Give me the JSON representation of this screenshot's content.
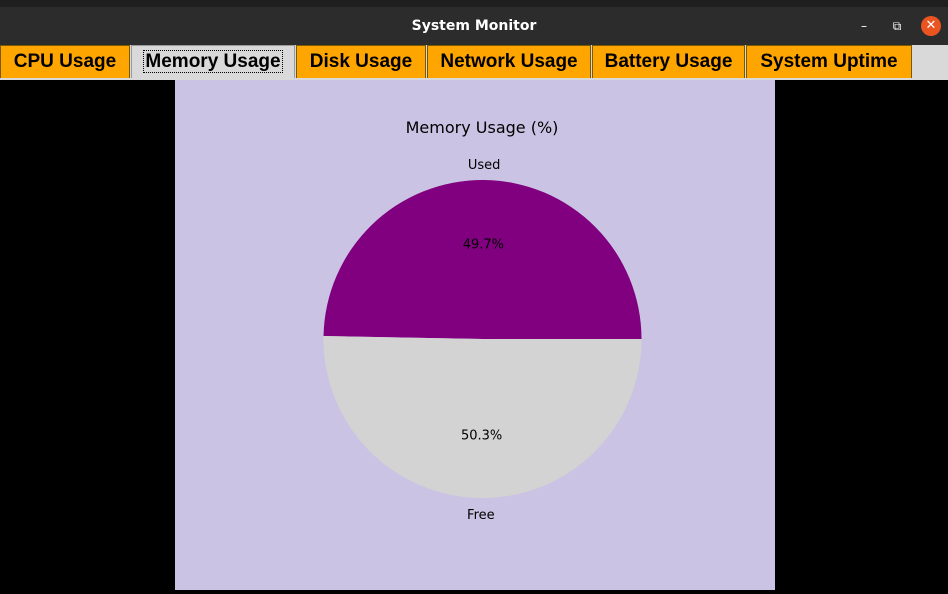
{
  "window": {
    "title": "System Monitor",
    "minimize_glyph": "–",
    "maximize_glyph": "⧉",
    "close_glyph": "✕"
  },
  "tabs": [
    {
      "label": "CPU Usage",
      "active": false
    },
    {
      "label": "Memory Usage",
      "active": true
    },
    {
      "label": "Disk Usage",
      "active": false
    },
    {
      "label": "Network Usage",
      "active": false
    },
    {
      "label": "Battery Usage",
      "active": false
    },
    {
      "label": "System Uptime",
      "active": false
    }
  ],
  "colors": {
    "tab_bg": "#ffa500",
    "figure_bg": "#cbc3e3",
    "used": "#800080",
    "free": "#d3d3d3"
  },
  "chart_data": {
    "type": "pie",
    "title": "Memory Usage (%)",
    "labels": [
      "Used",
      "Free"
    ],
    "values": [
      49.7,
      50.3
    ],
    "autopct_labels": [
      "49.7%",
      "50.3%"
    ],
    "colors": [
      "#800080",
      "#d3d3d3"
    ],
    "start_angle": 0,
    "legend": "none"
  }
}
